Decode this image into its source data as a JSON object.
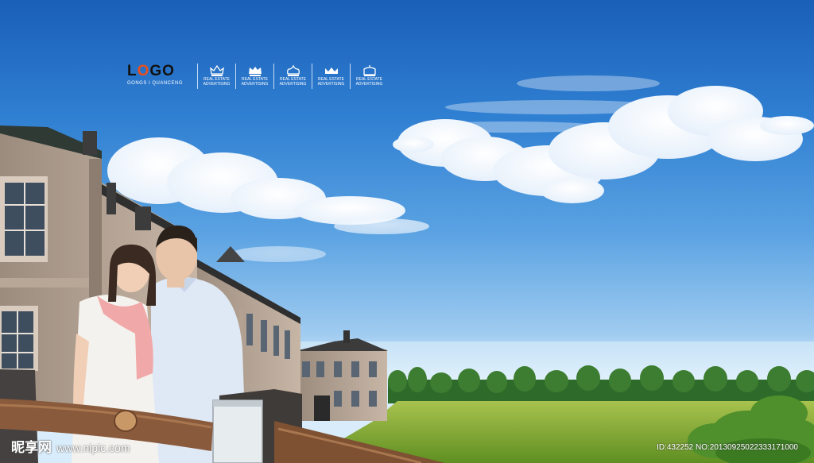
{
  "logo": {
    "text_l": "L",
    "text_o": "O",
    "text_go": "GO",
    "subtitle": "GONGS I QUANCENG"
  },
  "emblems": [
    {
      "icon": "crown-icon",
      "caption_1": "REAL ESTATE",
      "caption_2": "ADVERTISING"
    },
    {
      "icon": "crown-icon",
      "caption_1": "REAL ESTATE",
      "caption_2": "ADVERTISING"
    },
    {
      "icon": "crown-icon",
      "caption_1": "REAL ESTATE",
      "caption_2": "ADVERTISING"
    },
    {
      "icon": "crown-icon",
      "caption_1": "REAL ESTATE",
      "caption_2": "ADVERTISING"
    },
    {
      "icon": "crown-icon",
      "caption_1": "REAL ESTATE",
      "caption_2": "ADVERTISING"
    }
  ],
  "watermark": {
    "brand": "昵享网",
    "url": "www.nipic.com"
  },
  "image_id": "ID:432252 NO:20130925022333171000",
  "colors": {
    "sky_top": "#1a5fb8",
    "grass": "#7fa83a",
    "logo_accent": "#e94e1b"
  }
}
